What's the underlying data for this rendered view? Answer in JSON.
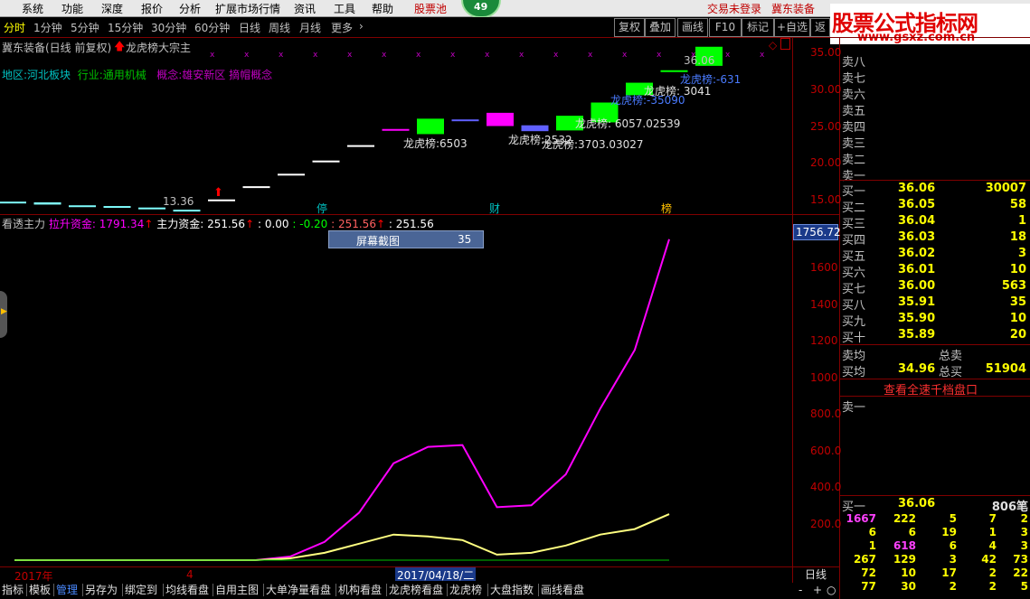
{
  "menubar": {
    "items": [
      "系统",
      "功能",
      "深度",
      "报价",
      "分析",
      "扩展市场行情",
      "资讯",
      "工具",
      "帮助",
      "股票池"
    ],
    "circle_value": "49",
    "right_items": [
      "交易未登录",
      "冀东装备"
    ]
  },
  "logo": {
    "main": "股票公式指标网",
    "url": "www.gsxz.com.cn"
  },
  "periods": [
    "分时",
    "1分钟",
    "5分钟",
    "15分钟",
    "30分钟",
    "60分钟",
    "日线",
    "周线",
    "月线",
    "更多"
  ],
  "toolbar": [
    "复权",
    "叠加",
    "画线",
    "F10",
    "标记",
    "+自选",
    "返"
  ],
  "chart_header": {
    "stock": "冀东装备(日线 前复权)",
    "indicator": "龙虎榜大宗主"
  },
  "info_line": {
    "region_label": "地区:",
    "region": "河北板块",
    "industry_label": "行业:",
    "industry": "通用机械",
    "concept_label": "概念:",
    "concept": "雄安新区 摘帽概念"
  },
  "price_chart": {
    "price_annotations": [
      "36.06",
      "13.36"
    ],
    "lhb_labels": [
      "龙虎榜:-631",
      "龙虎榜: 3041",
      "龙虎榜:-35090",
      "龙虎榜: 6057.02539",
      "龙虎榜:6503",
      "龙虎榜:2532",
      "龙虎榜:3703.03027"
    ],
    "markers": [
      "停",
      "财",
      "榜"
    ]
  },
  "chart_data": [
    {
      "type": "candlestick",
      "title": "冀东装备(日线 前复权)",
      "ylim": [
        13,
        37
      ],
      "yticks": [
        "15.00",
        "20.00",
        "25.00",
        "30.00",
        "35.00"
      ],
      "candles": [
        {
          "open": 14.7,
          "close": 14.7
        },
        {
          "open": 14.3,
          "close": 14.6
        },
        {
          "open": 14.1,
          "close": 14.2
        },
        {
          "open": 14.0,
          "close": 14.1
        },
        {
          "open": 13.7,
          "close": 13.9
        },
        {
          "open": 13.4,
          "close": 13.6
        },
        {
          "open": 15.0,
          "close": 15.0
        },
        {
          "open": 16.8,
          "close": 16.8
        },
        {
          "open": 18.5,
          "close": 18.5
        },
        {
          "open": 20.3,
          "close": 20.3
        },
        {
          "open": 22.4,
          "close": 22.4
        },
        {
          "open": 24.6,
          "close": 24.6
        },
        {
          "open": 23.9,
          "close": 26.0
        },
        {
          "open": 25.9,
          "close": 25.9
        },
        {
          "open": 25.0,
          "close": 26.8
        },
        {
          "open": 24.3,
          "close": 25.1
        },
        {
          "open": 24.4,
          "close": 26.4
        },
        {
          "open": 25.5,
          "close": 28.2
        },
        {
          "open": 29.2,
          "close": 30.9
        },
        {
          "open": 32.6,
          "close": 32.6
        },
        {
          "open": 33.2,
          "close": 35.8
        }
      ]
    },
    {
      "type": "line",
      "title": "看透主力",
      "series": [
        {
          "name": "拉升资金",
          "color": "#ff00ff",
          "values": [
            0,
            0,
            0,
            0,
            0,
            0,
            0,
            0,
            20,
            100,
            260,
            530,
            620,
            630,
            290,
            300,
            470,
            830,
            1150,
            1756.72
          ]
        },
        {
          "name": "主力资金",
          "color": "#ffff80",
          "values": [
            0,
            0,
            0,
            0,
            0,
            0,
            0,
            0,
            10,
            40,
            90,
            140,
            130,
            110,
            30,
            40,
            80,
            140,
            170,
            251.56
          ]
        }
      ],
      "ylim": [
        0,
        1800
      ],
      "yticks": [
        "200.0",
        "400.0",
        "600.0",
        "800.0",
        "1000",
        "1200",
        "1400",
        "1600"
      ],
      "current_value": "1756.72"
    }
  ],
  "indicator_line": {
    "name": "看透主力",
    "lift_label": "拉升资金: 1791.34",
    "main_label": "主力资金: 251.56",
    "v1": ": 0.00",
    "v2": ": -0.20",
    "v3": ": 251.56",
    "v4": ": 251.56"
  },
  "screenshot_box": {
    "label": "屏幕截图",
    "value": "35"
  },
  "orderbook": {
    "sells": [
      "卖八",
      "卖七",
      "卖六",
      "卖五",
      "卖四",
      "卖三",
      "卖二",
      "卖一"
    ],
    "buys": [
      {
        "label": "买一",
        "price": "36.06",
        "vol": "30007"
      },
      {
        "label": "买二",
        "price": "36.05",
        "vol": "58"
      },
      {
        "label": "买三",
        "price": "36.04",
        "vol": "1"
      },
      {
        "label": "买四",
        "price": "36.03",
        "vol": "18"
      },
      {
        "label": "买五",
        "price": "36.02",
        "vol": "3"
      },
      {
        "label": "买六",
        "price": "36.01",
        "vol": "10"
      },
      {
        "label": "买七",
        "price": "36.00",
        "vol": "563"
      },
      {
        "label": "买八",
        "price": "35.91",
        "vol": "35"
      },
      {
        "label": "买九",
        "price": "35.90",
        "vol": "10"
      },
      {
        "label": "买十",
        "price": "35.89",
        "vol": "20"
      }
    ],
    "avg_sell_label": "卖均",
    "total_sell_label": "总卖",
    "avg_buy_label": "买均",
    "avg_buy": "34.96",
    "total_buy_label": "总买",
    "total_buy": "51904",
    "link": "查看全速千档盘口",
    "sell1_label": "卖一",
    "buy1": {
      "label": "买一",
      "price": "36.06",
      "vol": "806笔"
    },
    "queue": [
      [
        "1667",
        "222",
        "5",
        "7",
        "2"
      ],
      [
        "6",
        "6",
        "19",
        "1",
        "3"
      ],
      [
        "1",
        "618",
        "6",
        "4",
        "3"
      ],
      [
        "267",
        "129",
        "3",
        "42",
        "73"
      ],
      [
        "72",
        "10",
        "17",
        "2",
        "22"
      ],
      [
        "77",
        "30",
        "2",
        "2",
        "5"
      ]
    ]
  },
  "xaxis": {
    "year": "2017年",
    "month": "4",
    "cursor_date": "2017/04/18/二"
  },
  "bottom_tabs": [
    "指标",
    "模板",
    "管理",
    "另存为",
    "绑定到",
    "均线看盘",
    "自用主图",
    "大单净量看盘",
    "机构看盘",
    "龙虎榜看盘",
    "龙虎榜",
    "大盘指数",
    "画线看盘"
  ],
  "status_right": {
    "period": "日线",
    "controls": [
      "-",
      "+",
      "○"
    ]
  }
}
